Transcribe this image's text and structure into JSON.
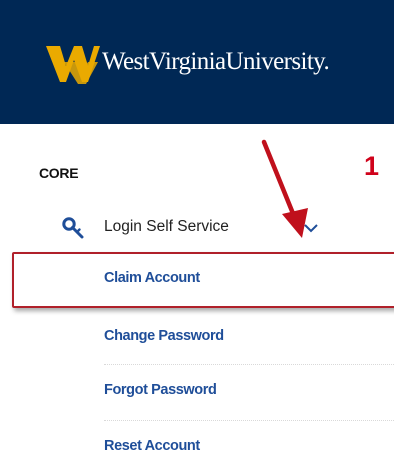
{
  "header": {
    "logo_text": "WestVirginiaUniversity.",
    "logo_icon": "flying-wv-icon"
  },
  "colors": {
    "header_bg": "#002855",
    "logo_gold": "#EAAA00",
    "link_blue": "#1F4E99",
    "annotation_red": "#D0021B"
  },
  "sidebar": {
    "section_title": "CORE",
    "parent": {
      "label": "Login Self Service",
      "icon": "key-icon",
      "chevron": "chevron-down-icon"
    },
    "items": [
      {
        "label": "Claim Account"
      },
      {
        "label": "Change Password"
      },
      {
        "label": "Forgot Password"
      },
      {
        "label": "Reset Account"
      }
    ]
  },
  "annotation": {
    "step_number": "1"
  }
}
